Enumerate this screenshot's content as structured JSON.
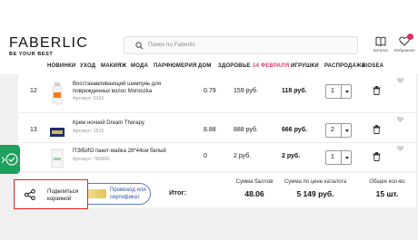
{
  "header": {
    "logo": "FABERLIC",
    "tagline": "BE YOUR BEST",
    "search_placeholder": "Поиск по Faberlic",
    "catalog_label": "Каталог",
    "favorites_label": "Избранное"
  },
  "nav": {
    "items": [
      "НОВИНКИ",
      "УХОД",
      "МАКИЯЖ",
      "МОДА",
      "ПАРФЮМЕРИЯ",
      "ДОМ",
      "ЗДОРОВЬЕ",
      "14 ФЕВРАЛЯ",
      "ИГРУШКИ",
      "РАСПРОДАЖА",
      "BIOSEA"
    ],
    "highlight_color": "#e23670"
  },
  "cart": {
    "rows": [
      {
        "num": "12",
        "name": "Восстанавливающий шампунь для поврежденных волос Moroozka",
        "article": "Артикул: 0192",
        "points": "0.79",
        "price": "159 руб.",
        "sum": "118 руб.",
        "qty": "1"
      },
      {
        "num": "13",
        "name": "Крем ночной Dream Therapy",
        "article": "Артикул: 2615",
        "points": "8.88",
        "price": "888 руб.",
        "sum": "666 руб.",
        "qty": "2"
      },
      {
        "num": "",
        "name": "ПЭ/БИО пакет-майка 28*44см белый",
        "article": "Артикул: 780900",
        "points": "0",
        "price": "2 руб.",
        "sum": "2 руб.",
        "qty": "1"
      }
    ]
  },
  "footer": {
    "share_label_1": "Поделиться",
    "share_label_2": "корзиной",
    "promo_label_1": "Промокод или",
    "promo_label_2": "сертификат",
    "total_label": "Итог:",
    "points_label": "Сумма баллов",
    "points_value": "48.06",
    "catalog_sum_label": "Сумма по цене каталога",
    "catalog_sum_value": "5 149 руб.",
    "qty_label": "Общее кол-во",
    "qty_value": "15 шт."
  },
  "colors": {
    "accent_pink": "#e23670",
    "fab_green": "#1ea05e",
    "share_highlight": "#e32020",
    "promo_blue": "#2b4fb5"
  }
}
